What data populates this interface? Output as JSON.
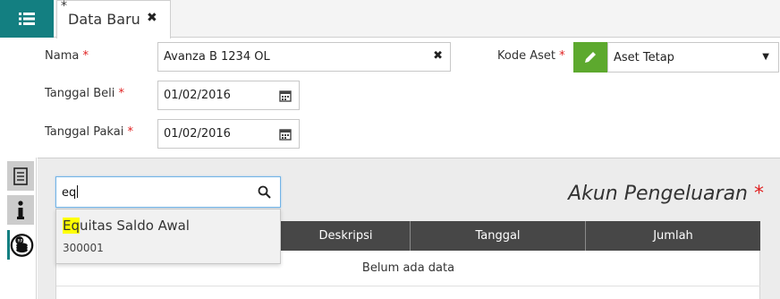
{
  "tab": {
    "modified_marker": "*",
    "title": "Data Baru",
    "close_glyph": "✖"
  },
  "form": {
    "nama": {
      "label": "Nama",
      "required": "*",
      "value": "Avanza B 1234 OL"
    },
    "tanggal_beli": {
      "label": "Tanggal Beli",
      "required": "*",
      "value": "01/02/2016"
    },
    "tanggal_pakai": {
      "label": "Tanggal Pakai",
      "required": "*",
      "value": "01/02/2016"
    },
    "kode_aset": {
      "label": "Kode Aset",
      "required": "*",
      "value": "Aset Tetap",
      "caret": "▼"
    }
  },
  "search": {
    "value": "eq"
  },
  "section": {
    "title": "Akun Pengeluaran",
    "required": "*"
  },
  "table": {
    "columns": [
      "Deskripsi",
      "Tanggal",
      "Jumlah"
    ],
    "empty_text": "Belum ada data"
  },
  "dropdown": {
    "item": {
      "highlight": "Eq",
      "rest": "uitas Saldo Awal",
      "code": "300001"
    }
  },
  "colors": {
    "teal": "#137f81",
    "green": "#5da92e",
    "required": "#e02020",
    "header": "#474747"
  },
  "icons": [
    "list-menu-icon",
    "close-icon",
    "calendar-icon",
    "pencil-icon",
    "search-icon",
    "document-icon",
    "info-icon",
    "money-icon"
  ]
}
